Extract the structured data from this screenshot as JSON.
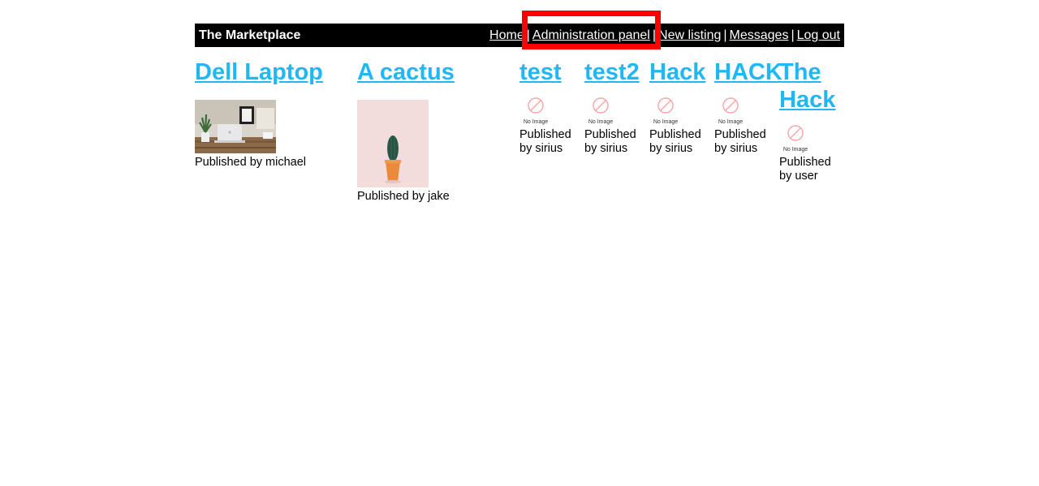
{
  "header": {
    "title": "The Marketplace",
    "nav": [
      {
        "label": "Home"
      },
      {
        "label": "Administration panel"
      },
      {
        "label": "New listing"
      },
      {
        "label": "Messages"
      },
      {
        "label": "Log out"
      }
    ],
    "separator": "|"
  },
  "listings": [
    {
      "title": "Dell Laptop",
      "image": "laptop-photo",
      "publisher": "Published by michael"
    },
    {
      "title": "A cactus",
      "image": "cactus-photo",
      "publisher": "Published by jake"
    },
    {
      "title": "test",
      "image": "no-image-icon",
      "image_caption": "No Image",
      "publisher": "Published by sirius"
    },
    {
      "title": "test2",
      "image": "no-image-icon",
      "image_caption": "No Image",
      "publisher": "Published by sirius"
    },
    {
      "title": "Hack",
      "image": "no-image-icon",
      "image_caption": "No Image",
      "publisher": "Published by sirius"
    },
    {
      "title": "HACK",
      "image": "no-image-icon",
      "image_caption": "No Image",
      "publisher": "Published by sirius"
    },
    {
      "title": "The Hack",
      "image": "no-image-icon",
      "image_caption": "No Image",
      "publisher": "Published by user"
    }
  ],
  "colors": {
    "header_bg": "#000000",
    "link": "#20b8f4",
    "highlight": "#ff0000"
  }
}
